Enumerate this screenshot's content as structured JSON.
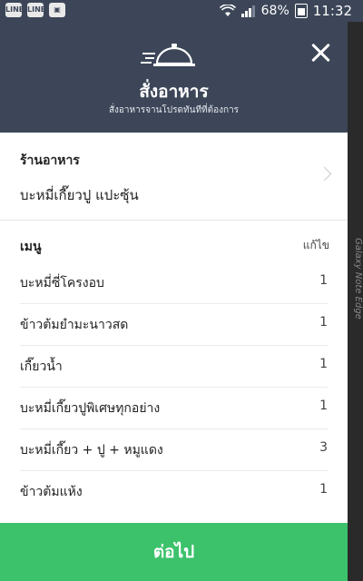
{
  "status_bar": {
    "left_icons": [
      "line-app-icon",
      "line-icon",
      "gallery-icon"
    ],
    "battery": "68%",
    "time": "11:32"
  },
  "header": {
    "title": "สั่งอาหาร",
    "subtitle": "สั่งอาหารจานโปรดทันทีที่ต้องการ"
  },
  "store": {
    "label": "ร้านอาหาร",
    "name": "บะหมี่เกี๊ยวปู แปะซุ้น"
  },
  "menu": {
    "label": "เมนู",
    "edit_label": "แก้ไข",
    "items": [
      {
        "name": "บะหมี่ซี่โครงอบ",
        "qty": "1"
      },
      {
        "name": "ข้าวต้มยำมะนาวสด",
        "qty": "1"
      },
      {
        "name": "เกี๊ยวน้ำ",
        "qty": "1"
      },
      {
        "name": "บะหมี่เกี๊ยวปูพิเศษทุกอย่าง",
        "qty": "1"
      },
      {
        "name": "บะหมี่เกี๊ยว + ปู + หมูแดง",
        "qty": "3"
      },
      {
        "name": "ข้าวต้มแห้ง",
        "qty": "1"
      }
    ]
  },
  "footer": {
    "next_label": "ต่อไป"
  },
  "side_text": "Galaxy Note Edge",
  "colors": {
    "header_bg": "#3c4658",
    "accent_green": "#3cc26b"
  }
}
